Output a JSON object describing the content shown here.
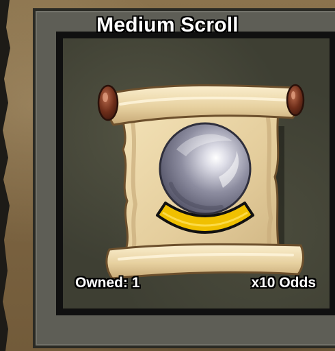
{
  "item": {
    "title": "Medium Scroll",
    "owned_text": "Owned: 1",
    "odds_text": "x10 Odds",
    "icon": "scroll-with-crystal-orb-icon"
  },
  "colors": {
    "card_background": "#3e3f33",
    "parchment": "#e6d0a0",
    "orb": "#8e8ea0",
    "gold_band": "#f0c000"
  }
}
